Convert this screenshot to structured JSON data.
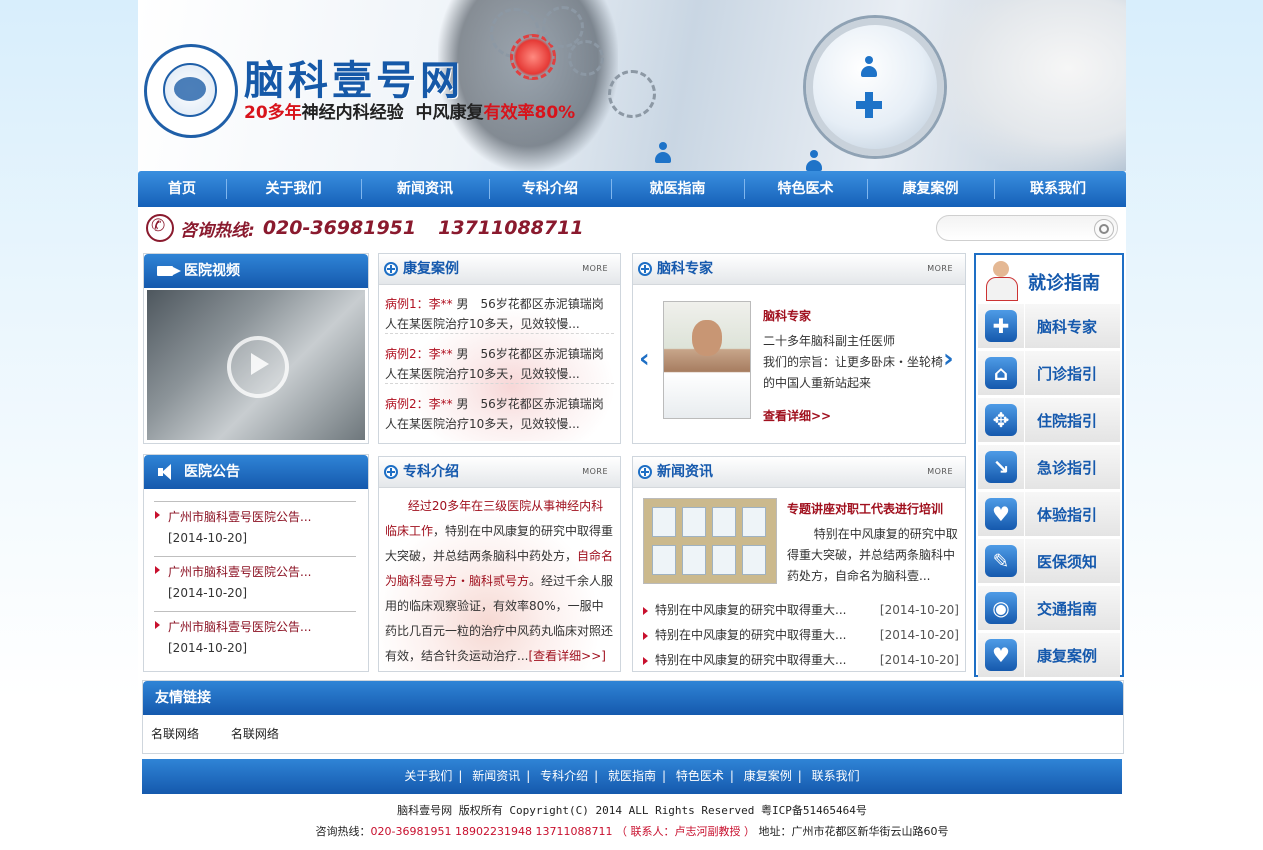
{
  "site": {
    "title": "脑科壹号网",
    "slogan_a": "20多年",
    "slogan_b": "神经内科经验",
    "slogan_c": "中风康复",
    "slogan_d": "有效率80%"
  },
  "nav": [
    {
      "label": "首页"
    },
    {
      "label": "关于我们"
    },
    {
      "label": "新闻资讯"
    },
    {
      "label": "专科介绍"
    },
    {
      "label": "就医指南"
    },
    {
      "label": "特色医术"
    },
    {
      "label": "康复案例"
    },
    {
      "label": "联系我们"
    }
  ],
  "hotline": {
    "label": "咨询热线:",
    "num1": "020-36981951",
    "num2": "13711088711"
  },
  "search": {
    "placeholder": ""
  },
  "video": {
    "title": "医院视频"
  },
  "notice": {
    "title": "医院公告",
    "items": [
      {
        "title": "广州市脑科壹号医院公告...",
        "date": "[2014-10-20]"
      },
      {
        "title": "广州市脑科壹号医院公告...",
        "date": "[2014-10-20]"
      },
      {
        "title": "广州市脑科壹号医院公告...",
        "date": "[2014-10-20]"
      }
    ]
  },
  "cases": {
    "title": "康复案例",
    "more": "MORE",
    "items": [
      {
        "name": "病例1：李**",
        "text": "男　56岁花都区赤泥镇瑞岗人在某医院治疗10多天，见效较慢..."
      },
      {
        "name": "病例2：李**",
        "text": "男　56岁花都区赤泥镇瑞岗人在某医院治疗10多天，见效较慢..."
      },
      {
        "name": "病例2：李**",
        "text": "男　56岁花都区赤泥镇瑞岗人在某医院治疗10多天，见效较慢..."
      }
    ]
  },
  "expert": {
    "title": "脑科专家",
    "more": "MORE",
    "name": "脑科专家",
    "desc1": "二十多年脑科副主任医师",
    "desc2": "我们的宗旨：让更多卧床・坐轮椅的中国人重新站起来",
    "detail": "查看详细>>",
    "prev": "‹",
    "next": "›"
  },
  "specialty": {
    "title": "专科介绍",
    "more": "MORE",
    "p1": "经过20多年在三级医院从事神经内科临床工作",
    "p2": "，特别在中风康复的研究中取得重大突破，并总结两条脑科中药处方，",
    "p3": "自命名为脑科壹号方・脑科贰号方",
    "p4": "。经过千余人服用的临床观察验证，有效率80%，一服中药比几百元一粒的治疗中风药丸临床对照还有效，结合针灸运动治疗...",
    "detail": "[查看详细>>]"
  },
  "news": {
    "title": "新闻资讯",
    "more": "MORE",
    "headline": "专题讲座对职工代表进行培训",
    "desc": "特别在中风康复的研究中取得重大突破，并总结两条脑科中药处方，自命名为脑科壹...",
    "items": [
      {
        "title": "特别在中风康复的研究中取得重大...",
        "date": "[2014-10-20]"
      },
      {
        "title": "特别在中风康复的研究中取得重大...",
        "date": "[2014-10-20]"
      },
      {
        "title": "特别在中风康复的研究中取得重大...",
        "date": "[2014-10-20]"
      }
    ]
  },
  "guide": {
    "title": "就诊指南",
    "items": [
      {
        "label": "脑科专家",
        "icon": "plus-icon",
        "glyph": "✚"
      },
      {
        "label": "门诊指引",
        "icon": "house-icon",
        "glyph": "⌂"
      },
      {
        "label": "住院指引",
        "icon": "arrows-icon",
        "glyph": "✥"
      },
      {
        "label": "急诊指引",
        "icon": "arrow-corner-icon",
        "glyph": "↘"
      },
      {
        "label": "体验指引",
        "icon": "heart-plus-icon",
        "glyph": "♥"
      },
      {
        "label": "医保须知",
        "icon": "document-icon",
        "glyph": "✎"
      },
      {
        "label": "交通指南",
        "icon": "traffic-light-icon",
        "glyph": "◉"
      },
      {
        "label": "康复案例",
        "icon": "heart-icon",
        "glyph": "♥"
      }
    ]
  },
  "links": {
    "title": "友情链接",
    "items": [
      "名联网络",
      "名联网络"
    ]
  },
  "footer": {
    "nav": [
      "关于我们",
      "新闻资讯",
      "专科介绍",
      "就医指南",
      "特色医术",
      "康复案例",
      "联系我们"
    ],
    "copyright": "脑科壹号网 版权所有 Copyright(C) 2014 ALL Rights Reserved 粤ICP备51465464号",
    "contact_label": "咨询热线：",
    "contact_numbers": "020-36981951  18902231948  13711088711",
    "contact_person": "（ 联系人：卢志河副教授 ）",
    "address": "地址：广州市花都区新华街云山路60号"
  },
  "colors": {
    "brand_blue": "#1559ad",
    "accent_red": "#a0101e"
  }
}
